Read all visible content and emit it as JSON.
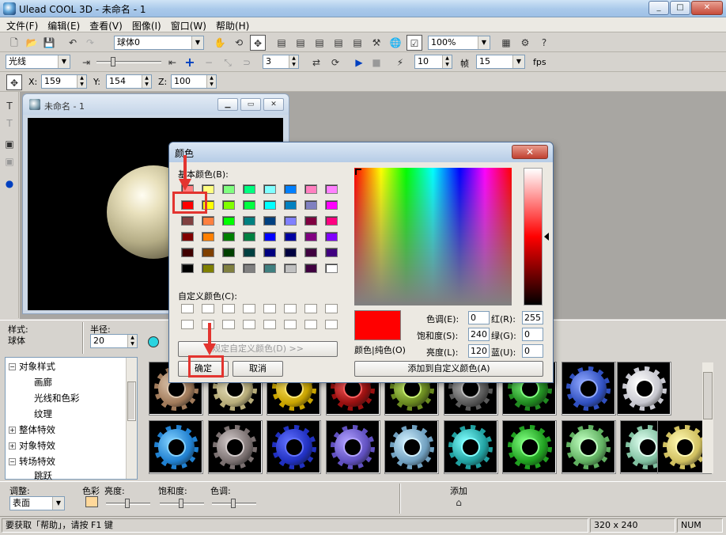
{
  "window": {
    "title": "Ulead COOL 3D - 未命名 - 1",
    "min": "_",
    "max": "□",
    "close": "✕"
  },
  "menu": [
    "文件(F)",
    "编辑(E)",
    "查看(V)",
    "图像(I)",
    "窗口(W)",
    "帮助(H)"
  ],
  "toolbar1": {
    "object_combo": "球体0",
    "zoom_combo": "100%"
  },
  "toolbar2": {
    "style_combo": "光线",
    "frame_value": "3",
    "speed_value": "10",
    "frame_label": "帧",
    "fps_value": "15",
    "fps_label": "fps"
  },
  "toolbar3": {
    "x_label": "X:",
    "x_value": "159",
    "y_label": "Y:",
    "y_value": "154",
    "z_label": "Z:",
    "z_value": "100"
  },
  "document": {
    "title": "未命名 - 1"
  },
  "properties": {
    "style_label": "样式:",
    "style_value": "球体",
    "radius_label": "半径:",
    "radius_value": "20"
  },
  "tree": [
    {
      "label": "对象样式",
      "expander": "−",
      "level": 0
    },
    {
      "label": "画廊",
      "level": 1
    },
    {
      "label": "光线和色彩",
      "level": 1
    },
    {
      "label": "纹理",
      "level": 1
    },
    {
      "label": "整体特效",
      "expander": "+",
      "level": 0
    },
    {
      "label": "对象特效",
      "expander": "+",
      "level": 0
    },
    {
      "label": "转场特效",
      "expander": "−",
      "level": 0
    },
    {
      "label": "跳跃",
      "level": 1
    }
  ],
  "thumbnails": [
    [
      "#a07a5a",
      "#e0c8b0"
    ],
    [
      "#b8ad7a",
      "#efe8c8"
    ],
    [
      "#c9a400",
      "#ffe870"
    ],
    [
      "#9a1010",
      "#ff6060"
    ],
    [
      "#6a8a20",
      "#c8f070"
    ],
    [
      "#5a5a5a",
      "#c0c0c0"
    ],
    [
      "#208a20",
      "#80ff80"
    ],
    [
      "#3050c0",
      "#90a8ff"
    ],
    [
      "#c8c8d0",
      "#ffffff"
    ],
    [
      "#2080d0",
      "#80d0ff"
    ],
    [
      "#7a7070",
      "#d0c8c8"
    ],
    [
      "#2030c0",
      "#6070ff"
    ],
    [
      "#6050c0",
      "#b0a0ff"
    ],
    [
      "#70a0c0",
      "#d0f0ff"
    ],
    [
      "#20a0a0",
      "#80ffff"
    ],
    [
      "#20a020",
      "#80ff80"
    ],
    [
      "#60b060",
      "#c0ffc0"
    ],
    [
      "#80c0a0",
      "#e0fff0"
    ],
    [
      "#d0c060",
      "#fff8b0"
    ]
  ],
  "adjust": {
    "adjust_label": "调整:",
    "adjust_combo": "表面",
    "color_label": "色彩",
    "brightness_label": "亮度:",
    "saturation_label": "饱和度:",
    "hue_label": "色调:",
    "add_label": "添加"
  },
  "status": {
    "help": "要获取「帮助」，请按 F1 键",
    "size": "320 x 240",
    "num": "NUM"
  },
  "dialog": {
    "title": "颜色",
    "close": "✕",
    "basic_colors_label": "基本颜色(B):",
    "basic_colors": [
      "#ff8080",
      "#ffff80",
      "#80ff80",
      "#00ff80",
      "#80ffff",
      "#0080ff",
      "#ff80c0",
      "#ff80ff",
      "#ff0000",
      "#ffff00",
      "#80ff00",
      "#00ff40",
      "#00ffff",
      "#0080c0",
      "#8080c0",
      "#ff00ff",
      "#804040",
      "#ff8040",
      "#00ff00",
      "#008080",
      "#004080",
      "#8080ff",
      "#800040",
      "#ff0080",
      "#800000",
      "#ff8000",
      "#008000",
      "#008040",
      "#0000ff",
      "#0000a0",
      "#800080",
      "#8000ff",
      "#400000",
      "#804000",
      "#004000",
      "#004040",
      "#000080",
      "#000040",
      "#400040",
      "#400080",
      "#000000",
      "#808000",
      "#808040",
      "#808080",
      "#408080",
      "#c0c0c0",
      "#400040",
      "#ffffff"
    ],
    "custom_colors_label": "自定义颜色(C):",
    "define_custom_button": "规定自定义颜色(D) >>",
    "ok_button": "确定",
    "cancel_button": "取消",
    "color_solid_label": "颜色|纯色(O)",
    "hue_label": "色调(E):",
    "hue_value": "0",
    "sat_label": "饱和度(S):",
    "sat_value": "240",
    "lum_label": "亮度(L):",
    "lum_value": "120",
    "red_label": "红(R):",
    "red_value": "255",
    "green_label": "绿(G):",
    "green_value": "0",
    "blue_label": "蓝(U):",
    "blue_value": "0",
    "add_custom_button": "添加到自定义颜色(A)",
    "selected_color": "#ff0000"
  },
  "colors": {
    "annotation": "#e3342f"
  }
}
